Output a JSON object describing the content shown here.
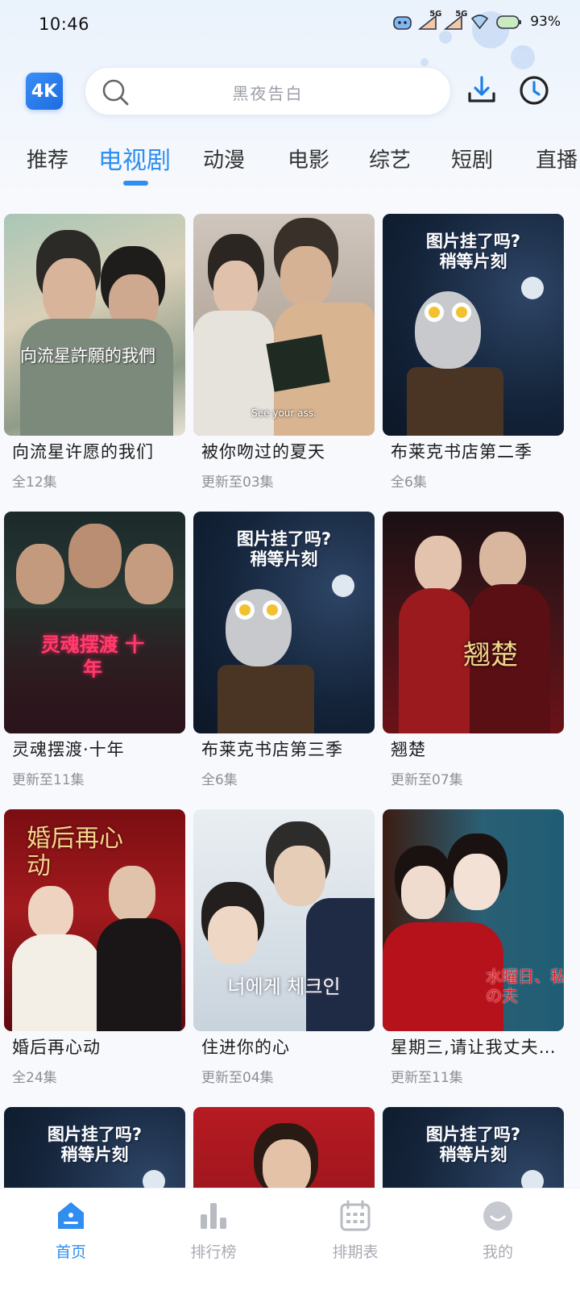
{
  "status_bar": {
    "time": "10:46",
    "net1": "5G",
    "net2": "5G",
    "battery": "93%"
  },
  "header": {
    "logo_text": "4K",
    "search_placeholder": "黑夜告白",
    "icons": [
      "download-icon",
      "history-clock-icon"
    ]
  },
  "tabs": [
    {
      "label": "推荐"
    },
    {
      "label": "电视剧",
      "active": true
    },
    {
      "label": "动漫"
    },
    {
      "label": "电影"
    },
    {
      "label": "综艺"
    },
    {
      "label": "短剧"
    },
    {
      "label": "直播"
    }
  ],
  "placeholder_text": "图片挂了吗?\n稍等片刻",
  "cards": [
    {
      "title": "向流星许愿的我们",
      "subtitle": "全12集",
      "poster_text": "向流星許願的我們"
    },
    {
      "title": "被你吻过的夏天",
      "subtitle": "更新至03集",
      "poster_text": "See your ass."
    },
    {
      "title": "布莱克书店第二季",
      "subtitle": "全6集",
      "placeholder": true
    },
    {
      "title": "灵魂摆渡·十年",
      "subtitle": "更新至11集",
      "poster_text": "灵魂摆渡 十年"
    },
    {
      "title": "布莱克书店第三季",
      "subtitle": "全6集",
      "placeholder": true
    },
    {
      "title": "翘楚",
      "subtitle": "更新至07集",
      "poster_text": "翘楚"
    },
    {
      "title": "婚后再心动",
      "subtitle": "全24集",
      "poster_text": "婚后再心动"
    },
    {
      "title": "住进你的心",
      "subtitle": "更新至04集",
      "poster_text": "너에게 체크인"
    },
    {
      "title": "星期三,请让我丈夫…",
      "subtitle": "更新至11集",
      "poster_text": "水曜日、私の夫"
    },
    {
      "title": "",
      "subtitle": "",
      "placeholder": true
    },
    {
      "title": "",
      "subtitle": "",
      "poster_text": ""
    },
    {
      "title": "",
      "subtitle": "",
      "placeholder": true
    }
  ],
  "bottom_nav": [
    {
      "label": "首页",
      "icon": "home-icon",
      "active": true
    },
    {
      "label": "排行榜",
      "icon": "ranking-bars-icon"
    },
    {
      "label": "排期表",
      "icon": "calendar-icon"
    },
    {
      "label": "我的",
      "icon": "profile-icon"
    }
  ],
  "colors": {
    "accent": "#2f8ef0",
    "inactive": "#a8abb2",
    "placeholder_bg": "#14243a"
  }
}
